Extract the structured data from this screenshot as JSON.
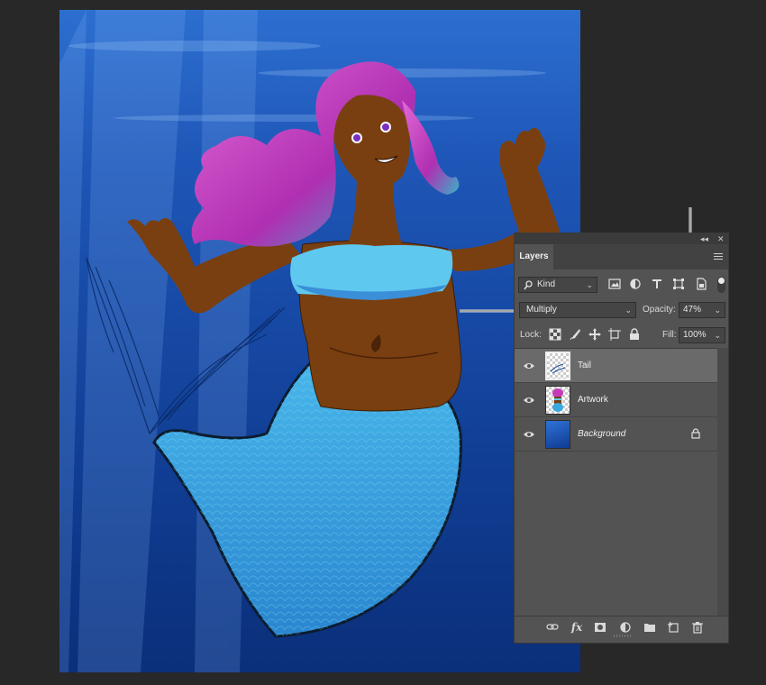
{
  "panel": {
    "collapse_glyph": "◂◂",
    "close_glyph": "✕",
    "tab_label": "Layers",
    "menu_icon": "hamburger-menu-icon",
    "filter": {
      "kind_label": "Kind",
      "icons": [
        "image-filter-icon",
        "adjustment-filter-icon",
        "type-filter-icon",
        "shape-filter-icon",
        "smart-object-filter-icon"
      ]
    },
    "blend_mode": "Multiply",
    "opacity_label": "Opacity:",
    "opacity_value": "47%",
    "lock_label": "Lock:",
    "fill_label": "Fill:",
    "fill_value": "100%",
    "layers": [
      {
        "name": "Tail",
        "selected": true,
        "visible": true,
        "thumb": "transparent-with-tail-sketch"
      },
      {
        "name": "Artwork",
        "selected": false,
        "visible": true,
        "thumb": "transparent-with-character"
      },
      {
        "name": "Background",
        "selected": false,
        "visible": true,
        "locked": true,
        "thumb": "blue-gradient"
      }
    ],
    "bottom_icons": [
      "link-layers-icon",
      "fx-icon",
      "add-mask-icon",
      "adjustment-layer-icon",
      "new-group-icon",
      "new-layer-icon",
      "trash-icon"
    ]
  },
  "colors": {
    "workspace": "#282828",
    "panel_bg": "#535353",
    "selected_row": "#6a6a6a",
    "ocean_top": "#2c6fd0",
    "ocean_bottom": "#0b2f7a",
    "hair": "#c63ab9",
    "skin": "#7a3f10",
    "top": "#5fc8ef",
    "tail": "#3ba9e0"
  }
}
